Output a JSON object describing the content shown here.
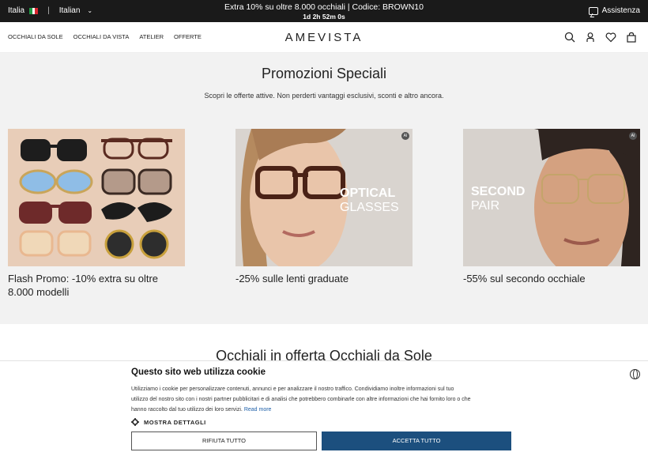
{
  "topbar": {
    "country": "Italia",
    "language": "Italian",
    "promo_line": "Extra 10% su oltre 8.000 occhiali | Codice: BROWN10",
    "countdown": "1d 2h 52m 0s",
    "assistance": "Assistenza"
  },
  "header": {
    "logo": "AMEVISTA",
    "nav": [
      "OCCHIALI DA SOLE",
      "OCCHIALI DA VISTA",
      "ATELIER",
      "OFFERTE"
    ]
  },
  "promo": {
    "title": "Promozioni Speciali",
    "subtitle": "Scopri le offerte attive. Non perderti vantaggi esclusivi, sconti e altro ancora.",
    "cards": [
      {
        "caption": "Flash Promo: -10% extra su oltre 8.000 modelli"
      },
      {
        "caption": "-25% sulle lenti graduate",
        "overlay_line1": "OPTICAL",
        "overlay_line2": "GLASSES",
        "badge": "AI"
      },
      {
        "caption": "-55% sul secondo occhiale",
        "overlay_line1": "SECOND",
        "overlay_line2": "PAIR",
        "badge": "AI"
      }
    ]
  },
  "section2": {
    "title": "Occhiali in offerta Occhiali da Sole"
  },
  "cookie": {
    "title": "Questo sito web utilizza cookie",
    "body": "Utilizziamo i cookie per personalizzare contenuti, annunci e per analizzare il nostro traffico. Condividiamo inoltre informazioni sul tuo utilizzo del nostro sito con i nostri partner pubblicitari e di analisi che potrebbero combinarle con altre informazioni che hai fornito loro o che hanno raccolto dal tuo utilizzo dei loro servizi.",
    "read_more": "Read more",
    "details": "MOSTRA DETTAGLI",
    "reject": "RIFIUTA TUTTO",
    "accept": "ACCETTA TUTTO"
  },
  "colors": {
    "accent": "#1c4f7e",
    "topbar": "#1a1a1a",
    "section_bg": "#f2f2f2"
  }
}
